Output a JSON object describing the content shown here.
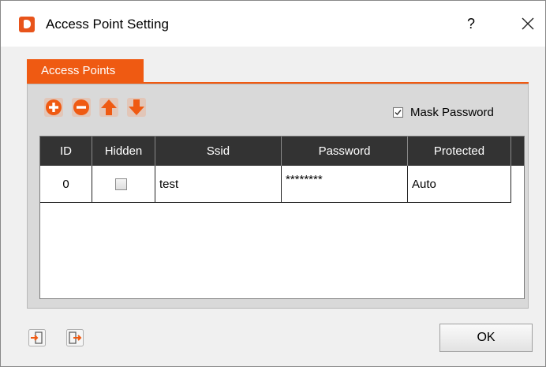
{
  "window": {
    "title": "Access Point Setting",
    "help_label": "?"
  },
  "tabs": [
    {
      "label": "Access Points",
      "active": true
    }
  ],
  "toolbar": {
    "buttons": [
      "add-icon",
      "remove-icon",
      "move-up-icon",
      "move-down-icon"
    ],
    "mask_password": {
      "label": "Mask Password",
      "checked": true
    }
  },
  "table": {
    "columns": [
      "ID",
      "Hidden",
      "Ssid",
      "Password",
      "Protected"
    ],
    "rows": [
      {
        "id": "0",
        "hidden": false,
        "ssid": "test",
        "password": "********",
        "protected": "Auto"
      }
    ]
  },
  "footer": {
    "import_icon": "import-icon",
    "export_icon": "export-icon",
    "ok_label": "OK"
  },
  "colors": {
    "accent": "#ef5a12",
    "header_bg": "#333333",
    "panel_bg": "#d9d9d9"
  }
}
